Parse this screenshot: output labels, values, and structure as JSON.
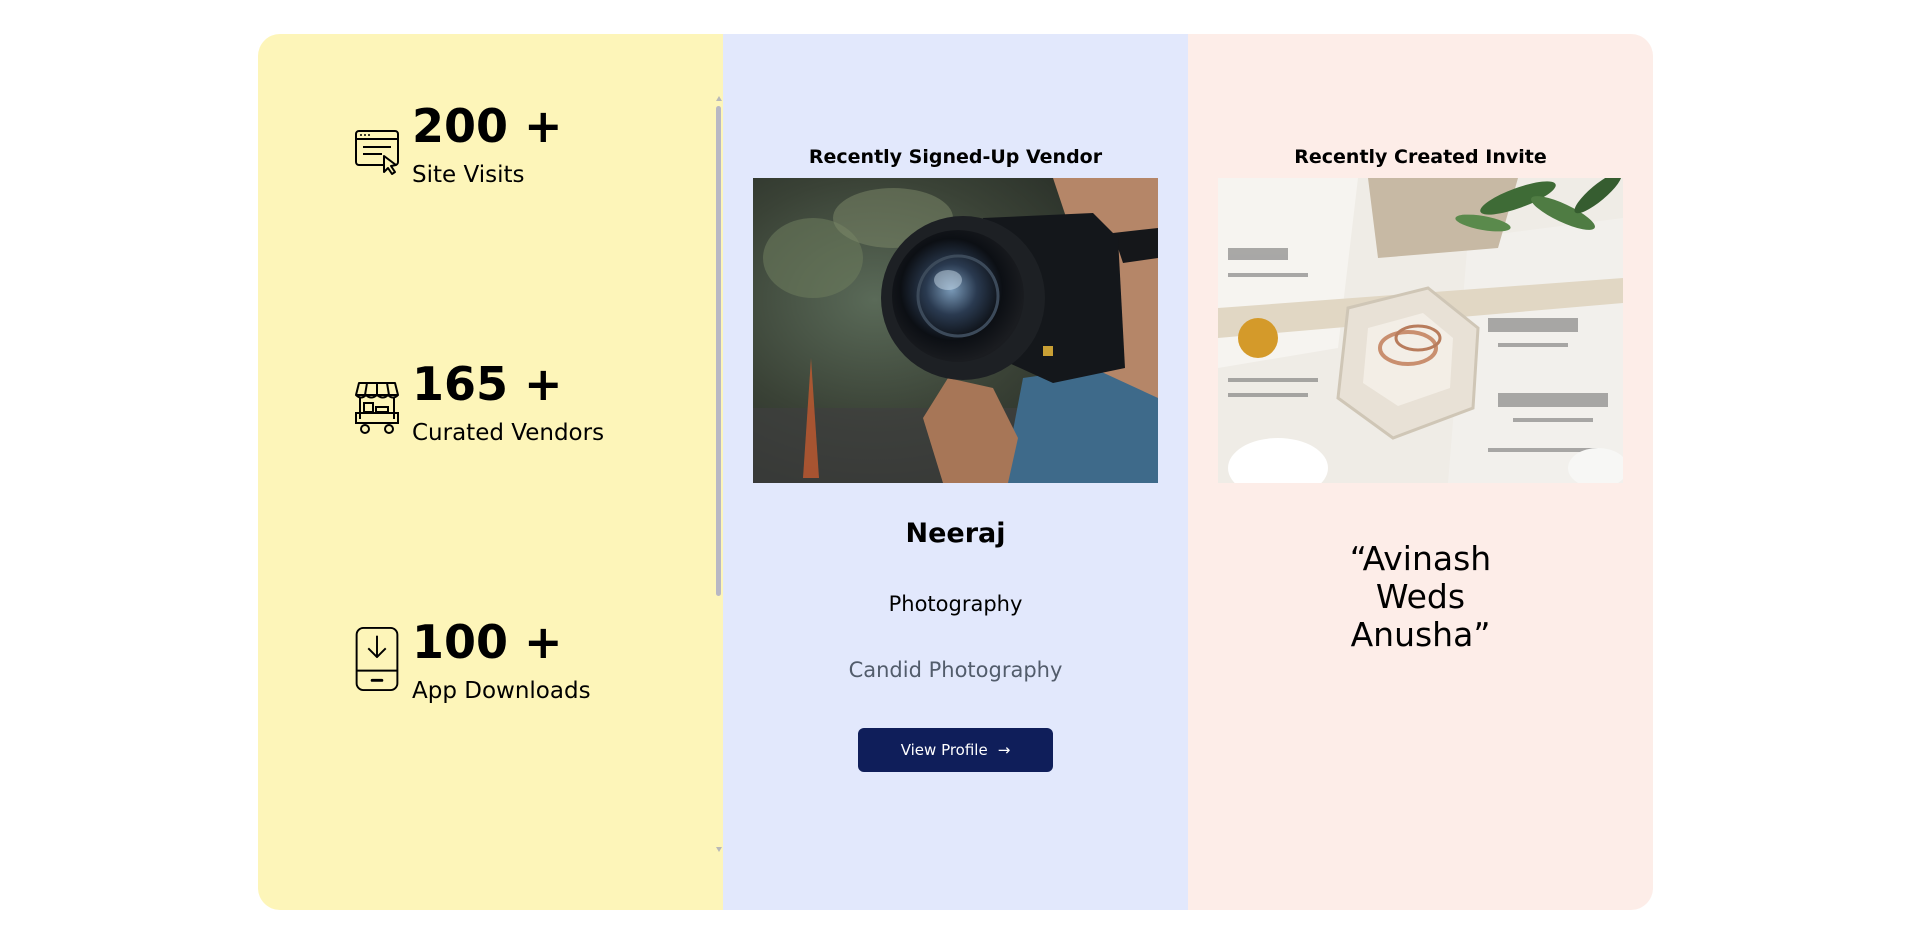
{
  "stats": [
    {
      "value": "200 +",
      "label": "Site Visits",
      "icon": "browser-cursor-icon"
    },
    {
      "value": "165 +",
      "label": "Curated Vendors",
      "icon": "vendor-cart-icon"
    },
    {
      "value": "100 +",
      "label": "App Downloads",
      "icon": "phone-download-icon"
    }
  ],
  "vendor": {
    "heading": "Recently Signed-Up Vendor",
    "image": "photographer-with-camera",
    "name": "Neeraj",
    "category": "Photography",
    "subcategory": "Candid Photography",
    "button_label": "View Profile",
    "button_icon": "arrow-right-icon"
  },
  "invite": {
    "heading": "Recently Created Invite",
    "image": "wedding-invitation-rings",
    "title_lines": [
      "“Avinash",
      "Weds",
      "Anusha”"
    ]
  },
  "colors": {
    "stats_panel": "#fdf5b9",
    "vendor_panel": "#e2e8fc",
    "invite_panel": "#fdede8",
    "button": "#0f1e5a",
    "subtext": "#525c6b"
  }
}
